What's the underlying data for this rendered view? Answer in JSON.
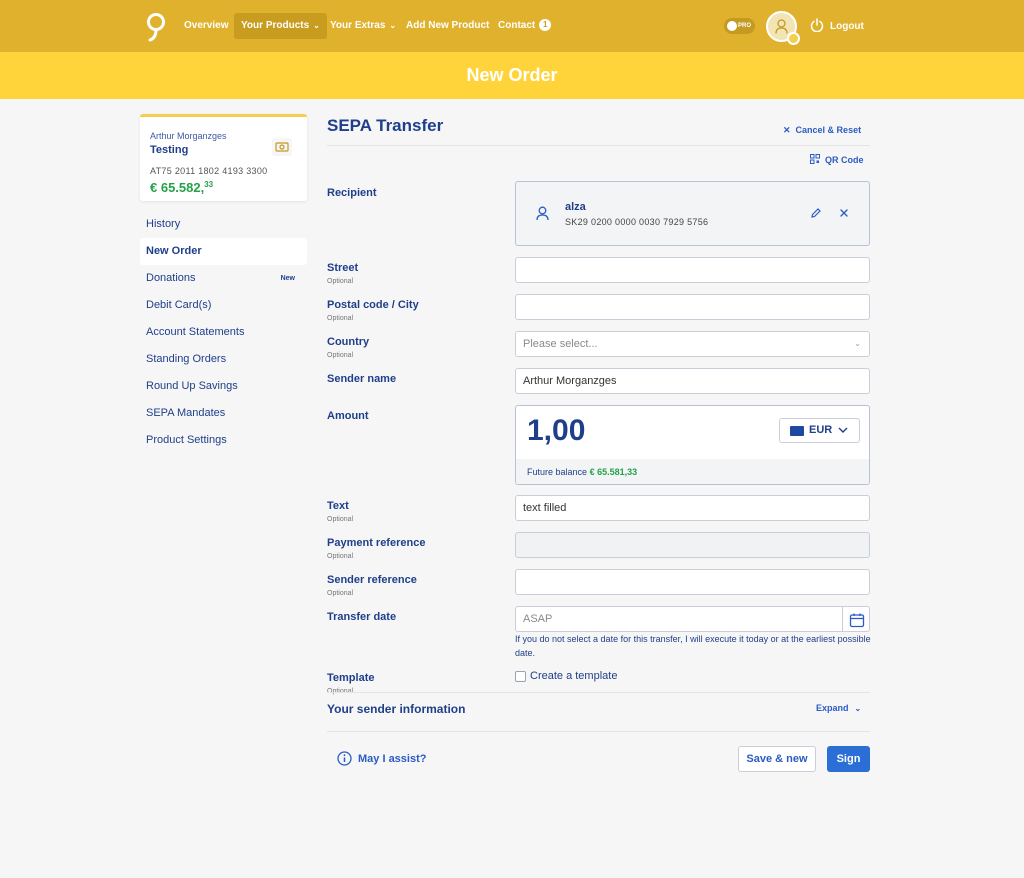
{
  "nav": {
    "items": [
      {
        "label": "Overview"
      },
      {
        "label": "Your Products"
      },
      {
        "label": "Your Extras"
      },
      {
        "label": "Add New Product"
      },
      {
        "label": "Contact",
        "badge": "1"
      }
    ],
    "pro_toggle": "PRO",
    "logout": "Logout"
  },
  "page": {
    "title": "New Order"
  },
  "account": {
    "owner": "Arthur Morganzges",
    "name": "Testing",
    "iban": "AT75 2011 1802 4193 3300",
    "balance_main": "€ 65.582,",
    "balance_cents": "33"
  },
  "sidebar": {
    "items": [
      {
        "label": "History"
      },
      {
        "label": "New Order"
      },
      {
        "label": "Donations",
        "badge": "New"
      },
      {
        "label": "Debit Card(s)"
      },
      {
        "label": "Account Statements"
      },
      {
        "label": "Standing Orders"
      },
      {
        "label": "Round Up Savings"
      },
      {
        "label": "SEPA Mandates"
      },
      {
        "label": "Product Settings"
      }
    ]
  },
  "form": {
    "title": "SEPA Transfer",
    "cancel_reset": "Cancel & Reset",
    "qr_code": "QR Code",
    "optional": "Optional",
    "recipient": {
      "label": "Recipient",
      "name": "alza",
      "iban": "SK29 0200 0000 0030 7929 5756"
    },
    "street": {
      "label": "Street",
      "value": ""
    },
    "postal_city": {
      "label": "Postal code / City",
      "value": ""
    },
    "country": {
      "label": "Country",
      "placeholder": "Please select..."
    },
    "sender_name": {
      "label": "Sender name",
      "value": "Arthur Morganzges"
    },
    "amount": {
      "label": "Amount",
      "value": "1,00",
      "currency": "EUR",
      "future_label": "Future balance",
      "future_value": "€ 65.581,33"
    },
    "text": {
      "label": "Text",
      "value": "text filled"
    },
    "payment_reference": {
      "label": "Payment reference",
      "value": ""
    },
    "sender_reference": {
      "label": "Sender reference",
      "value": ""
    },
    "transfer_date": {
      "label": "Transfer date",
      "placeholder": "ASAP",
      "hint": "If you do not select a date for this transfer, I will execute it today or at the earliest possible date."
    },
    "template": {
      "label": "Template",
      "checkbox_label": "Create a template"
    },
    "sender_info": {
      "title": "Your sender information",
      "expand": "Expand"
    }
  },
  "footer": {
    "assist": "May I assist?",
    "save_new": "Save & new",
    "sign": "Sign"
  },
  "colors": {
    "accent_dark": "#e0b12d",
    "accent_light": "#ffd43b",
    "primary": "#2b6fd6",
    "text_blue": "#1f3f8a",
    "positive": "#24a24a"
  }
}
